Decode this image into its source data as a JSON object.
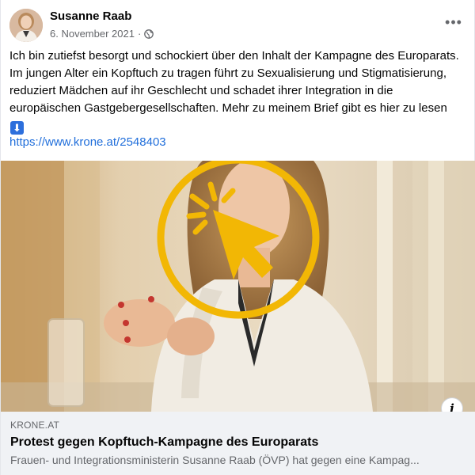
{
  "post": {
    "author": "Susanne Raab",
    "date": "6. November 2021",
    "meta_separator": "·",
    "privacy_icon": "globe-icon",
    "more_icon": "more-dots-icon",
    "more_label": "•••",
    "text": "Ich bin zutiefst besorgt und schockiert über den Inhalt der Kampagne des Europarats. Im jungen Alter ein Kopftuch zu tragen führt zu Sexualisierung und Stigmatisierung, reduziert Mädchen auf ihr Geschlecht und schadet ihrer Integration in die europäischen Gastgebergesellschaften. Mehr zu meinem Brief gibt es hier zu lesen",
    "text_emoji": "⬇",
    "link": "https://www.krone.at/2548403"
  },
  "preview": {
    "overlay_icon": "click-cursor-icon",
    "info_icon": "info-icon",
    "info_label": "i",
    "domain": "KRONE.AT",
    "title": "Protest gegen Kopftuch-Kampagne des Europarats",
    "description": "Frauen- und Integrationsministerin Susanne Raab (ÖVP) hat gegen eine Kampag..."
  },
  "colors": {
    "link": "#216fdb",
    "overlay_accent": "#f2b705",
    "footer_bg": "#f0f2f5",
    "meta_text": "#65676b"
  }
}
